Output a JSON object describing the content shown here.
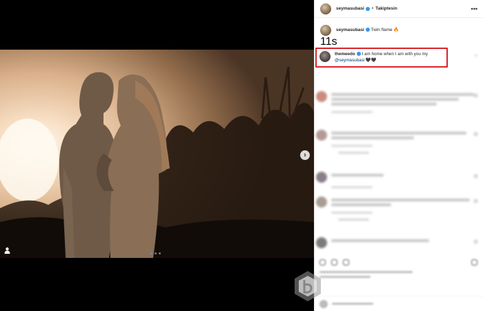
{
  "post": {
    "author": {
      "username": "seymasubasi",
      "follow_label": "Takiptesin",
      "separator": "•"
    },
    "caption": {
      "username": "seymasubasi",
      "text": "Twin flame 🔥",
      "time": "11s"
    },
    "highlighted_comment": {
      "username": "themeedo",
      "text": "I am home when I am with you my",
      "mention": "@seymasubasi",
      "trailing": "🖤🖤"
    },
    "carousel": {
      "slide_count": 3,
      "active_index": 0
    }
  },
  "icons": {
    "more": "more-options-icon",
    "next": "chevron-right-icon",
    "heart": "heart-icon",
    "tag": "user-tag-icon",
    "verified": "verified-badge-icon"
  },
  "colors": {
    "highlight_border": "#d8232a",
    "verified_blue": "#3897f0",
    "mention": "#00376b"
  }
}
